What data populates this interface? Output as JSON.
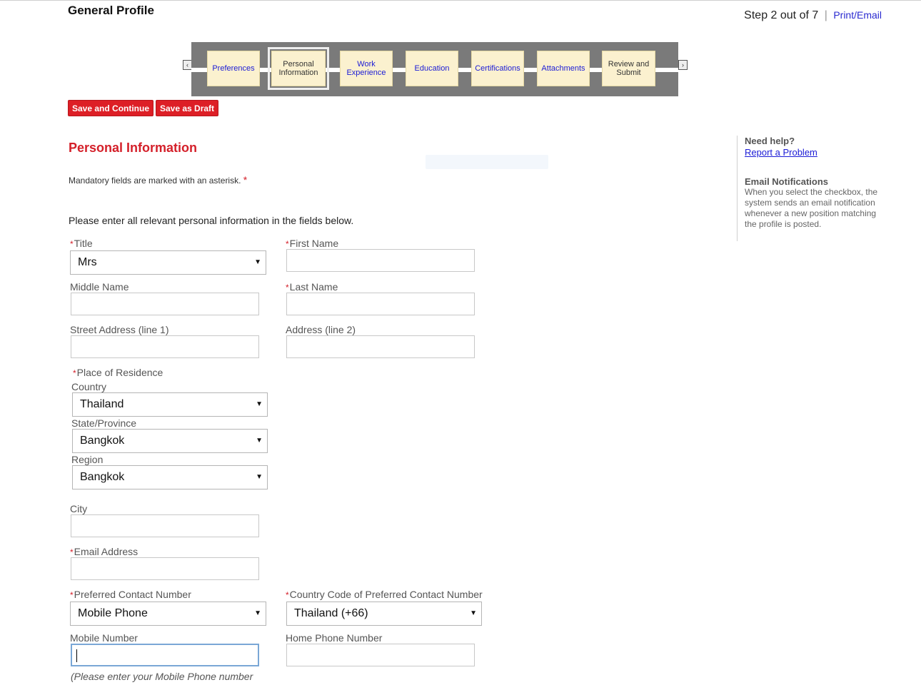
{
  "header": {
    "title": "General Profile",
    "step_text": "Step 2 out of 7",
    "separator": "|",
    "print_email": "Print/Email"
  },
  "train": {
    "prev_glyph": "‹",
    "next_glyph": "›",
    "steps": [
      {
        "label": "Preferences"
      },
      {
        "label": "Personal Information"
      },
      {
        "label": "Work Experience"
      },
      {
        "label": "Education"
      },
      {
        "label": "Certifications"
      },
      {
        "label": "Attachments"
      },
      {
        "label": "Review and Submit"
      }
    ]
  },
  "buttons": {
    "save_continue": "Save and Continue",
    "save_draft": "Save as Draft"
  },
  "section": {
    "title": "Personal Information",
    "mandatory_note": "Mandatory fields are marked with an asterisk.",
    "asterisk": "*",
    "intro": "Please enter all relevant personal information in the fields below."
  },
  "form": {
    "title_label": "Title",
    "title_value": "Mrs",
    "first_name_label": "First Name",
    "middle_name_label": "Middle Name",
    "last_name_label": "Last Name",
    "street1_label": "Street Address (line 1)",
    "address2_label": "Address (line 2)",
    "residence_label": "Place of Residence",
    "country_label": "Country",
    "country_value": "Thailand",
    "state_label": "State/Province",
    "state_value": "Bangkok",
    "region_label": "Region",
    "region_value": "Bangkok",
    "city_label": "City",
    "email_label": "Email Address",
    "pref_contact_label": "Preferred Contact Number",
    "pref_contact_value": "Mobile Phone",
    "country_code_label": "Country Code of Preferred Contact Number",
    "country_code_value": "Thailand (+66)",
    "mobile_label": "Mobile Number",
    "home_phone_label": "Home Phone Number",
    "mobile_hint": "(Please enter your Mobile Phone number"
  },
  "help": {
    "need_help": "Need help?",
    "report_link": "Report a Problem",
    "email_notif_title": "Email Notifications",
    "email_notif_text": "When you select the checkbox, the system sends an email notification whenever a new position matching the profile is posted."
  }
}
